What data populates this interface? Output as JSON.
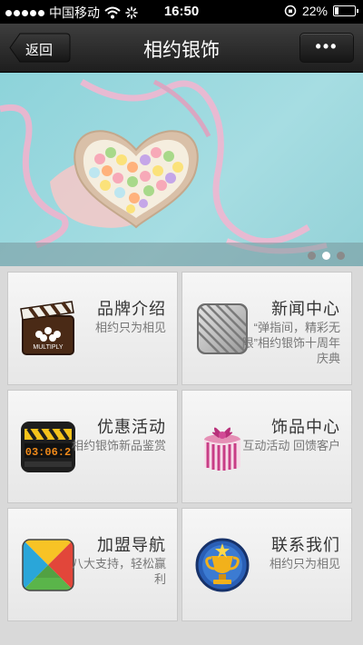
{
  "status_bar": {
    "carrier": "中国移动",
    "time": "16:50",
    "battery_text": "22%",
    "battery_level": 0.22
  },
  "nav": {
    "back_label": "返回",
    "title": "相约银饰",
    "more_label": "•••"
  },
  "banner": {
    "page_count": 3,
    "active_page": 2
  },
  "tiles": [
    {
      "title": "品牌介绍",
      "desc": "相约只为相见",
      "icon": "clapperboard-icon",
      "icon_text": "MULTIPLY"
    },
    {
      "title": "新闻中心",
      "desc": "“弹指间，精彩无限”相约银饰十周年庆典",
      "icon": "striped-square-icon"
    },
    {
      "title": "优惠活动",
      "desc": "相约银饰新品鉴赏",
      "icon": "countdown-clapper-icon",
      "icon_text": "03:06:2"
    },
    {
      "title": "饰品中心",
      "desc": "互动活动 回馈客户",
      "icon": "gift-box-icon"
    },
    {
      "title": "加盟导航",
      "desc": "八大支持，轻松赢利",
      "icon": "colorful-triangles-icon"
    },
    {
      "title": "联系我们",
      "desc": "相约只为相见",
      "icon": "trophy-badge-icon"
    }
  ]
}
